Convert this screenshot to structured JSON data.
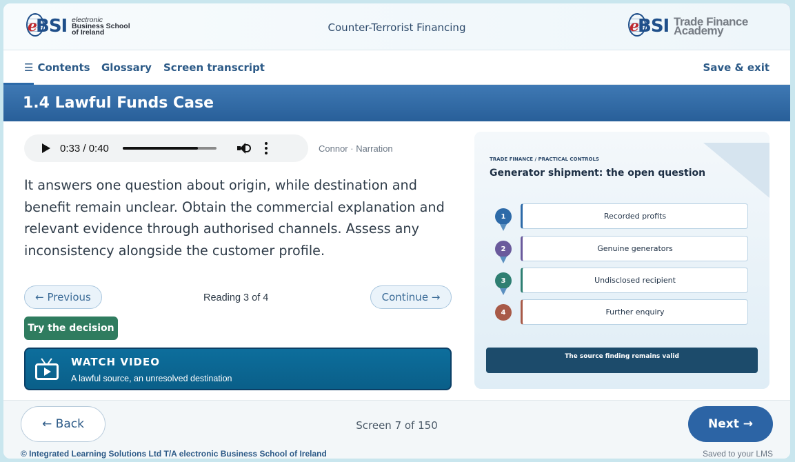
{
  "header": {
    "left_logo": {
      "mark": "BSI",
      "lines": [
        "electronic",
        "Business School",
        "of Ireland"
      ]
    },
    "course_title": "Counter-Terrorist Financing",
    "right_logo": {
      "mark": "BSI",
      "lines": [
        "Trade Finance",
        "Academy"
      ]
    }
  },
  "nav": {
    "contents": "Contents",
    "contents_icon": "menu-icon",
    "glossary": "Glossary",
    "transcript": "Screen transcript",
    "save_exit": "Save & exit"
  },
  "page": {
    "title": "1.4 Lawful Funds Case"
  },
  "audio": {
    "time": "0:33 / 0:40",
    "progress": 0.8,
    "narrator": "Connor · Narration"
  },
  "body": {
    "text": "It answers one question about origin, while destination and benefit remain unclear. Obtain the commercial explanation and relevant evidence through authorised channels. Assess any inconsistency alongside the customer profile."
  },
  "reading_nav": {
    "previous": "← Previous",
    "status": "Reading 3 of 4",
    "continue": "Continue →"
  },
  "try_decision": "Try the decision",
  "video": {
    "heading": "WATCH VIDEO",
    "subtitle": "A lawful source, an unresolved destination",
    "icon": "tv-icon"
  },
  "panel": {
    "eyebrow": "TRADE FINANCE / PRACTICAL CONTROLS",
    "title": "Generator shipment: the open question",
    "steps": [
      {
        "num": "1",
        "label": "Recorded profits",
        "color": "#2d6aa8"
      },
      {
        "num": "2",
        "label": "Genuine generators",
        "color": "#6a5a9c"
      },
      {
        "num": "3",
        "label": "Undisclosed recipient",
        "color": "#2f7f72"
      },
      {
        "num": "4",
        "label": "Further enquiry",
        "color": "#a85a48"
      }
    ],
    "finding": "The source finding remains valid"
  },
  "footer": {
    "back": "← Back",
    "screen": "Screen 7 of 150",
    "next": "Next →",
    "copyright": "© Integrated Learning Solutions Ltd T/A electronic Business School of Ireland",
    "saved": "Saved to your LMS"
  },
  "colors": {
    "accent": "#2c64a5",
    "title_bar": "#3570ab",
    "try_button": "#2f7c5f",
    "video_card": "#0d6e9c",
    "finding_bar": "#1c4b6b"
  }
}
